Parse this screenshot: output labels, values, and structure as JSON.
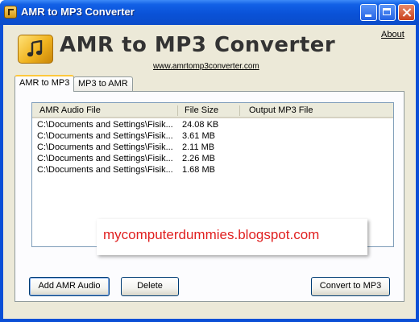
{
  "window": {
    "title": "AMR to MP3 Converter",
    "titlebar_color": "#0a52d8"
  },
  "header": {
    "app_title": "AMR to MP3 Converter",
    "website": "www.amrtomp3converter.com",
    "about_label": "About"
  },
  "tabs": [
    {
      "label": "AMR to MP3",
      "selected": true
    },
    {
      "label": "MP3 to AMR",
      "selected": false
    }
  ],
  "file_list": {
    "columns": [
      "AMR Audio File",
      "File Size",
      "Output MP3 File"
    ],
    "rows": [
      {
        "file": "C:\\Documents and Settings\\Fisik...",
        "size": "24.08 KB",
        "output": ""
      },
      {
        "file": "C:\\Documents and Settings\\Fisik...",
        "size": "3.61 MB",
        "output": ""
      },
      {
        "file": "C:\\Documents and Settings\\Fisik...",
        "size": "2.11 MB",
        "output": ""
      },
      {
        "file": "C:\\Documents and Settings\\Fisik...",
        "size": "2.26 MB",
        "output": ""
      },
      {
        "file": "C:\\Documents and Settings\\Fisik...",
        "size": "1.68 MB",
        "output": ""
      }
    ]
  },
  "watermark": {
    "text": "mycomputerdummies.blogspot.com",
    "color": "#e02020"
  },
  "buttons": {
    "add": "Add AMR Audio",
    "delete": "Delete",
    "convert": "Convert to MP3"
  }
}
